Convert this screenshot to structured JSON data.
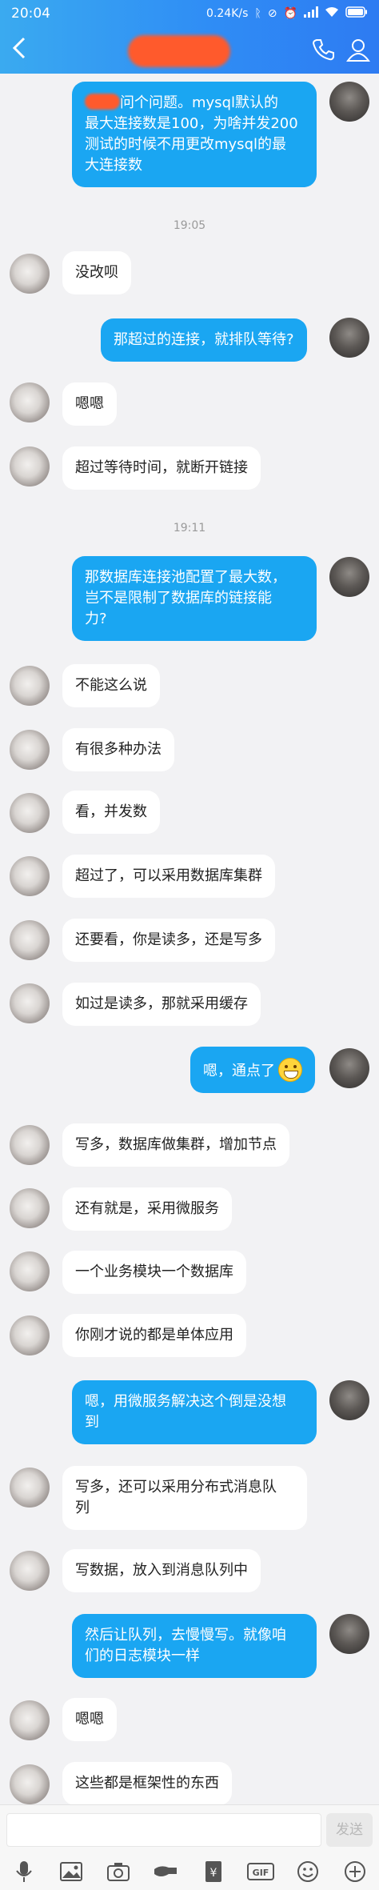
{
  "status_bar": {
    "time": "20:04",
    "speed": "0.24K/s"
  },
  "header": {
    "back_label": "<"
  },
  "messages": [
    {
      "side": "right",
      "lines": [
        "问个问题。mysql默认的",
        "最大连接数是100，为啥并发200",
        "测试的时候不用更改mysql的最",
        "大连接数"
      ]
    },
    {
      "side": "time",
      "text": "19:05"
    },
    {
      "side": "left",
      "text": "没改呗"
    },
    {
      "side": "right",
      "text": "那超过的连接，就排队等待?"
    },
    {
      "side": "left",
      "text": "嗯嗯"
    },
    {
      "side": "left",
      "text": "超过等待时间，就断开链接"
    },
    {
      "side": "time",
      "text": "19:11"
    },
    {
      "side": "right",
      "lines": [
        "那数据库连接池配置了最大数，",
        "岂不是限制了数据库的链接能",
        "力?"
      ]
    },
    {
      "side": "left",
      "text": "不能这么说"
    },
    {
      "side": "left",
      "text": "有很多种办法"
    },
    {
      "side": "left",
      "text": "看，并发数"
    },
    {
      "side": "left",
      "text": "超过了，可以采用数据库集群"
    },
    {
      "side": "left",
      "text": "还要看，你是读多，还是写多"
    },
    {
      "side": "left",
      "text": "如过是读多，那就采用缓存"
    },
    {
      "side": "right",
      "text": "嗯，通点了",
      "emoji": "grinning-emoji"
    },
    {
      "side": "left",
      "text": "写多，数据库做集群，增加节点"
    },
    {
      "side": "left",
      "text": "还有就是，采用微服务"
    },
    {
      "side": "left",
      "text": "一个业务模块一个数据库"
    },
    {
      "side": "left",
      "text": "你刚才说的都是单体应用"
    },
    {
      "side": "right",
      "lines": [
        "嗯，用微服务解决这个倒是没想",
        "到"
      ]
    },
    {
      "side": "left",
      "lines": [
        "写多，还可以采用分布式消息队",
        "列"
      ]
    },
    {
      "side": "left",
      "text": "写数据，放入到消息队列中"
    },
    {
      "side": "right",
      "lines": [
        "然后让队列，去慢慢写。就像咱",
        "们的日志模块一样"
      ]
    },
    {
      "side": "left",
      "text": "嗯嗯"
    },
    {
      "side": "left",
      "text": "这些都是框架性的东西"
    }
  ],
  "input_bar": {
    "send_label": "发送",
    "placeholder": ""
  },
  "toolbar": {
    "icons": [
      "microphone-icon",
      "image-icon",
      "camera-icon",
      "hongbao-icon",
      "red-packet-icon",
      "gif-icon",
      "emoji-icon",
      "plus-icon"
    ],
    "gif_label": "GIF"
  },
  "colors": {
    "header_blue": "#2f8df5",
    "bubble_blue": "#1aa6f2",
    "redaction": "#ff5a2c"
  }
}
